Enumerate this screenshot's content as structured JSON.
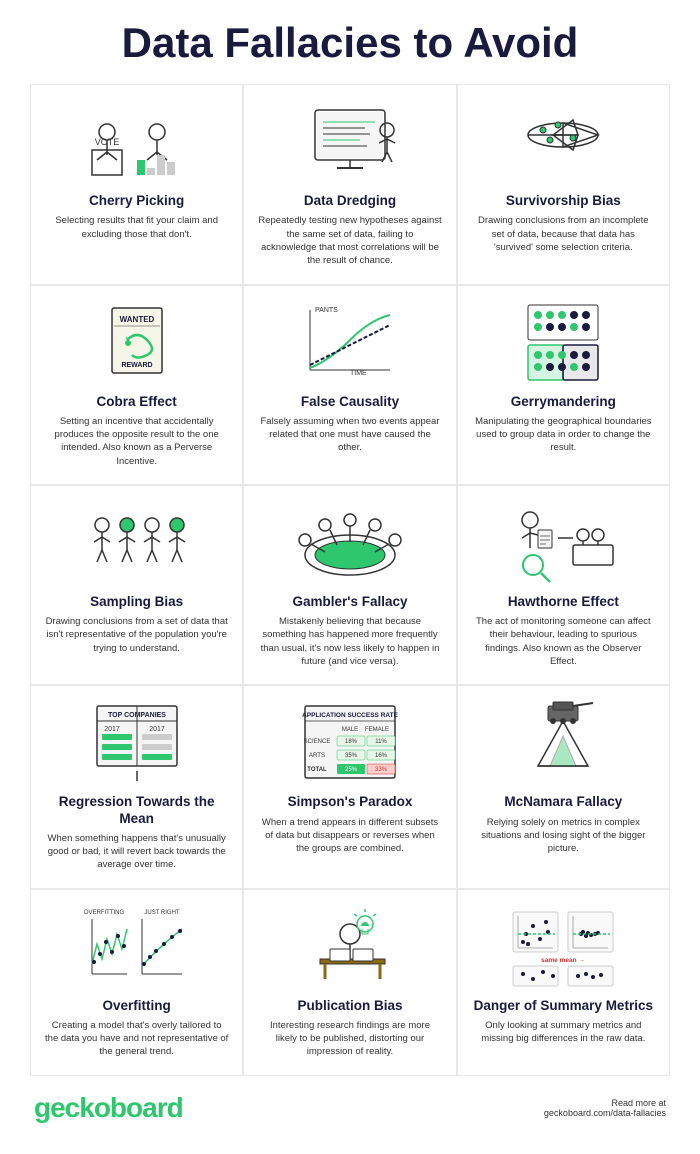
{
  "title": "Data Fallacies to Avoid",
  "cards": [
    {
      "id": "cherry-picking",
      "title": "Cherry Picking",
      "description": "Selecting results that fit your claim and excluding those that don't."
    },
    {
      "id": "data-dredging",
      "title": "Data Dredging",
      "description": "Repeatedly testing new hypotheses against the same set of data, failing to acknowledge that most correlations will be the result of chance."
    },
    {
      "id": "survivorship-bias",
      "title": "Survivorship Bias",
      "description": "Drawing conclusions from an incomplete set of data, because that data has 'survived' some selection criteria."
    },
    {
      "id": "cobra-effect",
      "title": "Cobra Effect",
      "description": "Setting an incentive that accidentally produces the opposite result to the one intended. Also known as a Perverse Incentive."
    },
    {
      "id": "false-causality",
      "title": "False Causality",
      "description": "Falsely assuming when two events appear related that one must have caused the other."
    },
    {
      "id": "gerrymandering",
      "title": "Gerrymandering",
      "description": "Manipulating the geographical boundaries used to group data in order to change the result."
    },
    {
      "id": "sampling-bias",
      "title": "Sampling Bias",
      "description": "Drawing conclusions from a set of data that isn't representative of the population you're trying to understand."
    },
    {
      "id": "gamblers-fallacy",
      "title": "Gambler's Fallacy",
      "description": "Mistakenly believing that because something has happened more frequently than usual, it's now less likely to happen in future (and vice versa)."
    },
    {
      "id": "hawthorne-effect",
      "title": "Hawthorne Effect",
      "description": "The act of monitoring someone can affect their behaviour, leading to spurious findings. Also known as the Observer Effect."
    },
    {
      "id": "regression-towards-mean",
      "title": "Regression Towards the Mean",
      "description": "When something happens that's unusually good or bad, it will revert back towards the average over time."
    },
    {
      "id": "simpsons-paradox",
      "title": "Simpson's Paradox",
      "description": "When a trend appears in different subsets of data but disappears or reverses when the groups are combined."
    },
    {
      "id": "mcnamara-fallacy",
      "title": "McNamara Fallacy",
      "description": "Relying solely on metrics in complex situations and losing sight of the bigger picture."
    },
    {
      "id": "overfitting",
      "title": "Overfitting",
      "description": "Creating a model that's overly tailored to the data you have and not representative of the general trend."
    },
    {
      "id": "publication-bias",
      "title": "Publication Bias",
      "description": "Interesting research findings are more likely to be published, distorting our impression of reality."
    },
    {
      "id": "danger-summary-metrics",
      "title": "Danger of Summary Metrics",
      "description": "Only looking at summary metrics and missing big differences in the raw data."
    }
  ],
  "footer": {
    "brand": "geckoboard",
    "read_more": "Read more at",
    "url": "geckoboard.com/data-fallacies"
  }
}
